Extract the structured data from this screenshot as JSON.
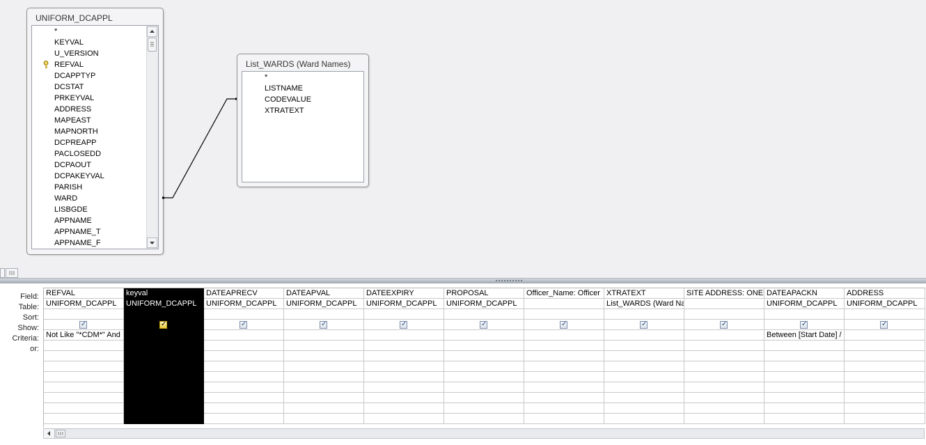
{
  "tables": [
    {
      "title": "UNIFORM_DCAPPL",
      "fields": [
        "*",
        "KEYVAL",
        "U_VERSION",
        "REFVAL",
        "DCAPPTYP",
        "DCSTAT",
        "PRKEYVAL",
        "ADDRESS",
        "MAPEAST",
        "MAPNORTH",
        "DCPREAPP",
        "PACLOSEDD",
        "DCPAOUT",
        "DCPAKEYVAL",
        "PARISH",
        "WARD",
        "LISBGDE",
        "APPNAME",
        "APPNAME_T",
        "APPNAME_F"
      ],
      "key_field": "REFVAL"
    },
    {
      "title": "List_WARDS (Ward Names)",
      "fields": [
        "*",
        "LISTNAME",
        "CODEVALUE",
        "XTRATEXT"
      ]
    }
  ],
  "grid": {
    "row_labels": [
      "Field:",
      "Table:",
      "Sort:",
      "Show:",
      "Criteria:",
      "or:"
    ],
    "columns": [
      {
        "field": "REFVAL",
        "table": "UNIFORM_DCAPPL",
        "sort": "",
        "show": true,
        "criteria": "Not Like \"*CDM*\" And",
        "or": ""
      },
      {
        "field": "keyval",
        "table": "UNIFORM_DCAPPL",
        "sort": "",
        "show": true,
        "criteria": "",
        "or": "",
        "selected": true
      },
      {
        "field": "DATEAPRECV",
        "table": "UNIFORM_DCAPPL",
        "sort": "",
        "show": true,
        "criteria": "",
        "or": ""
      },
      {
        "field": "DATEAPVAL",
        "table": "UNIFORM_DCAPPL",
        "sort": "",
        "show": true,
        "criteria": "",
        "or": ""
      },
      {
        "field": "DATEEXPIRY",
        "table": "UNIFORM_DCAPPL",
        "sort": "",
        "show": true,
        "criteria": "",
        "or": ""
      },
      {
        "field": "PROPOSAL",
        "table": "UNIFORM_DCAPPL",
        "sort": "",
        "show": true,
        "criteria": "",
        "or": ""
      },
      {
        "field": "Officer_Name: Officer",
        "table": "",
        "sort": "",
        "show": true,
        "criteria": "",
        "or": ""
      },
      {
        "field": "XTRATEXT",
        "table": "List_WARDS (Ward Na",
        "sort": "",
        "show": true,
        "criteria": "",
        "or": ""
      },
      {
        "field": "SITE ADDRESS: ONELII",
        "table": "",
        "sort": "",
        "show": true,
        "criteria": "",
        "or": ""
      },
      {
        "field": "DATEAPACKN",
        "table": "UNIFORM_DCAPPL",
        "sort": "",
        "show": true,
        "criteria": "Between [Start Date] /",
        "or": ""
      },
      {
        "field": "ADDRESS",
        "table": "UNIFORM_DCAPPL",
        "sort": "",
        "show": true,
        "criteria": "",
        "or": ""
      }
    ]
  },
  "icons": {
    "key": "key-icon",
    "checkbox": "checkbox-checked-icon",
    "scroll_up": "scroll-up-arrow-icon",
    "scroll_down": "scroll-down-arrow-icon",
    "scroll_left": "scroll-left-arrow-icon"
  },
  "colors": {
    "design_background": "#f0f0f2",
    "selected_column": "#000000",
    "checkbox_mark": "#2a4e8a"
  }
}
